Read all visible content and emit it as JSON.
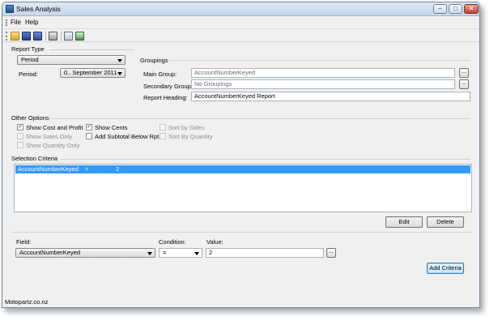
{
  "window": {
    "title": "Sales Analysis",
    "minimize": "–",
    "maximize": "□",
    "close": "✕"
  },
  "menu": {
    "items": [
      "File",
      "Help"
    ]
  },
  "toolbar": {
    "icons": [
      "open-folder-icon",
      "save-icon",
      "save-as-icon",
      "print-icon",
      "print-preview-icon",
      "export-excel-icon"
    ]
  },
  "report_type": {
    "section_label": "Report Type",
    "type_value": "Period",
    "period_label": "Period:",
    "period_value": "0.. September 2011"
  },
  "groupings": {
    "section_label": "Groupings",
    "main_group_label": "Main Group:",
    "main_group_value": "AccountNumberKeyed",
    "secondary_group_label": "Secondary Group:",
    "secondary_group_value": "No Groupings",
    "report_heading_label": "Report Heading:",
    "report_heading_value": "AccountNumberKeyed Report",
    "ellipsis": "..."
  },
  "other_options": {
    "section_label": "Other Options",
    "checked_mark": "✓",
    "items": [
      {
        "label": "Show Cost and Profit",
        "checked": true,
        "enabled": true
      },
      {
        "label": "Show Cents",
        "checked": true,
        "enabled": true
      },
      {
        "label": "Sort by Sales",
        "checked": false,
        "enabled": false
      },
      {
        "label": "Show Sales Only",
        "checked": false,
        "enabled": false
      },
      {
        "label": "Add Subtotal Below Rpt",
        "checked": false,
        "enabled": true
      },
      {
        "label": "Sort By Quantity",
        "checked": false,
        "enabled": false
      },
      {
        "label": "Show Quantity Only",
        "checked": false,
        "enabled": false
      }
    ]
  },
  "selection_criteria": {
    "section_label": "Selection Criteria",
    "rows": [
      {
        "field": "AccountNumberKeyed",
        "operator": "=",
        "value": "2"
      }
    ],
    "edit_label": "Edit",
    "delete_label": "Delete"
  },
  "criteria_entry": {
    "field_label": "Field:",
    "field_value": "AccountNumberKeyed",
    "condition_label": "Condition:",
    "condition_value": "=",
    "value_label": "Value:",
    "value_value": "2",
    "add_label": "Add Criteria"
  },
  "status": {
    "text": "Motopartz.co.nz"
  }
}
